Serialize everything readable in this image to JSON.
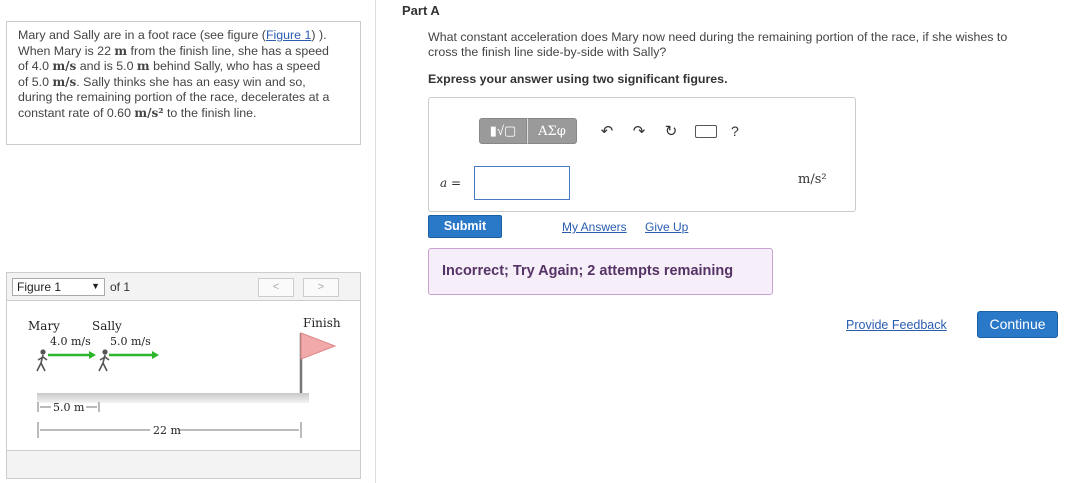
{
  "problem": {
    "line1_pre": "Mary and Sally are in a foot race (see figure (",
    "figure_link": "Figure 1",
    "line1_post": ") ).",
    "line2_pre": "When Mary is 22 ",
    "unit_m": "m",
    "line2_post": " from the finish line, she has a speed",
    "line3_pre": "of 4.0 ",
    "unit_ms": "m/s",
    "line3_mid": " and is 5.0 ",
    "line3_post": " behind Sally, who has a speed",
    "line4_pre": "of 5.0 ",
    "line4_post": ". Sally thinks she has an easy win and so,",
    "line5": "during the remaining portion of the race, decelerates at a",
    "line6_pre": "constant rate of 0.60 ",
    "unit_ms2": "m/s²",
    "line6_post": " to the finish line."
  },
  "figure": {
    "selector_value": "Figure 1",
    "of_label": "of 1",
    "prev_label": "<",
    "next_label": ">",
    "finish_label": "Finish",
    "mary_label": "Mary",
    "sally_label": "Sally",
    "mary_speed": "4.0 m/s",
    "sally_speed": "5.0 m/s",
    "gap_label": "5.0 m",
    "distance_label": "22 m"
  },
  "part": {
    "title": "Part A",
    "question_line1": "What constant acceleration does Mary now need during the remaining portion of the race, if she wishes to",
    "question_line2": "cross the finish line side-by-side with Sally?",
    "instruction": "Express your answer using two significant figures."
  },
  "toolbar": {
    "templates_icon": "▮√▢",
    "greek_label": "ΑΣφ",
    "undo_icon": "↶",
    "redo_icon": "↷",
    "reset_icon": "↻",
    "help_label": "?"
  },
  "answer": {
    "variable": "a",
    "equals": " =",
    "value": "",
    "unit": "m/s²"
  },
  "actions": {
    "submit_label": "Submit",
    "my_answers_label": "My Answers",
    "give_up_label": "Give Up",
    "feedback_text": "Incorrect; Try Again; 2 attempts remaining",
    "provide_feedback_label": "Provide Feedback",
    "continue_label": "Continue"
  },
  "colors": {
    "link": "#2a5db0",
    "primary_button": "#2a78c8",
    "feedback_bg": "#f6eef8",
    "feedback_border": "#c9a2d1",
    "arrow_green": "#2db52d",
    "flag_pink": "#f2a9a9"
  }
}
